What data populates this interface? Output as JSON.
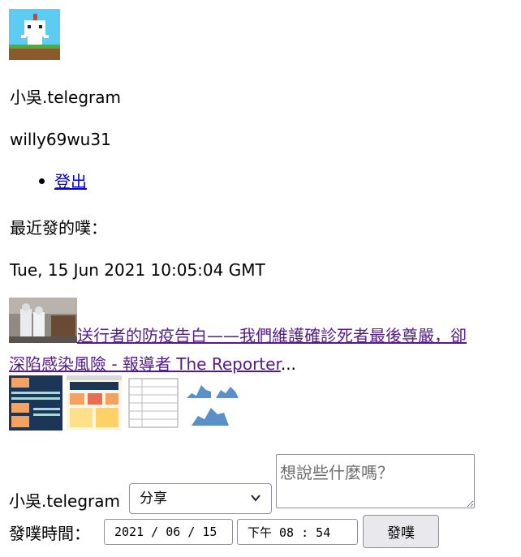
{
  "profile": {
    "display_name": "小吳.telegram",
    "username": "willy69wu31",
    "avatar_icon": "pixel-cat-icon"
  },
  "nav": {
    "logout_label": "登出"
  },
  "recent": {
    "heading": "最近發的噗：",
    "timestamp": "Tue, 15 Jun 2021 10:05:04 GMT",
    "link_line1": "送行者的防疫告白——我們維護確診死者最後尊嚴，卻",
    "link_line2": "深陷感染風險 - 報導者 The Reporter",
    "ellipsis": "..."
  },
  "composer": {
    "poster_name": "小吳.telegram",
    "qualifier_selected": "分享",
    "qualifier_options": [
      "分享"
    ],
    "message_placeholder": "想說些什麼嗎？",
    "time_label": "發噗時間：",
    "date_display": "2021 / 06 / 15",
    "time_display": "下午 08 : 54",
    "submit_label": "發噗"
  }
}
